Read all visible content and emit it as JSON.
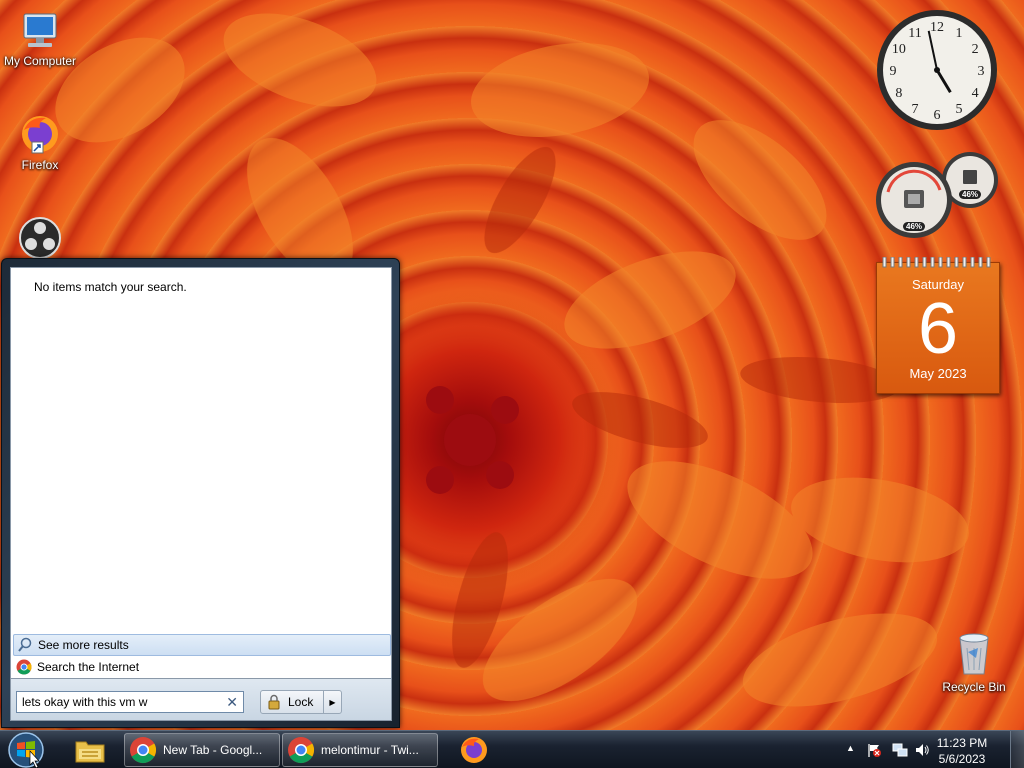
{
  "desktop": {
    "icons": [
      {
        "label": "My Computer",
        "icon": "computer-icon"
      },
      {
        "label": "Firefox",
        "icon": "firefox-icon"
      },
      {
        "label": "",
        "icon": "obs-icon"
      },
      {
        "label": "Recycle Bin",
        "icon": "recycle-bin-icon"
      }
    ],
    "clock_numbers": [
      "12",
      "1",
      "2",
      "3",
      "4",
      "5",
      "6",
      "7",
      "8",
      "9",
      "10",
      "11"
    ],
    "clock_time": {
      "hour": 4,
      "minute": 58
    },
    "meter": {
      "cpu": "46%",
      "memory": "46%"
    },
    "calendar": {
      "day_of_week": "Saturday",
      "day": "6",
      "month_year": "May 2023"
    }
  },
  "start_menu": {
    "no_results": "No items match your search.",
    "see_more": "See more results",
    "search_internet": "Search the Internet",
    "search_value": "lets okay with this vm w",
    "clear_glyph": "✕",
    "lock_label": "Lock",
    "lock_arrow": "▶"
  },
  "taskbar": {
    "buttons": [
      {
        "label": "New Tab - Googl...",
        "icon": "chrome-icon"
      },
      {
        "label": "melontimur - Twi...",
        "icon": "chrome-icon"
      }
    ],
    "pinned": [
      "explorer-icon",
      "firefox-icon"
    ],
    "time": "11:23 PM",
    "date": "5/6/2023",
    "tray_chevron": "▲"
  },
  "colors": {
    "accent_orange": "#e06a1c",
    "taskbar": "#1a2230",
    "highlight": "#cddff3"
  }
}
